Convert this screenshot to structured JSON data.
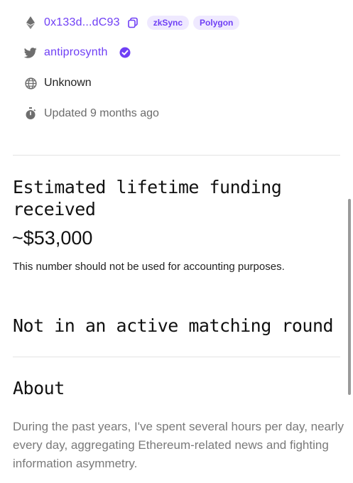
{
  "wallet": {
    "address": "0x133d...dC93",
    "chains": [
      "zkSync",
      "Polygon"
    ]
  },
  "twitter": {
    "handle": "antiprosynth"
  },
  "website": {
    "label": "Unknown"
  },
  "updated": {
    "label": "Updated 9 months ago"
  },
  "funding": {
    "heading": "Estimated lifetime funding received",
    "amount": "~$53,000",
    "note": "This number should not be used for accounting purposes."
  },
  "matching": {
    "heading": "Not in an active matching round"
  },
  "about": {
    "heading": "About",
    "body": "During the past years, I've spent several hours per day, nearly every day, aggregating Ethereum-related news and fighting information asymmetry."
  },
  "colors": {
    "accent": "#6f3ff5",
    "pill_bg": "#efe9ff",
    "muted": "#6b6b6b"
  },
  "icons": [
    "ethereum-icon",
    "copy-icon",
    "twitter-icon",
    "verified-badge-icon",
    "globe-icon",
    "stopwatch-icon"
  ]
}
